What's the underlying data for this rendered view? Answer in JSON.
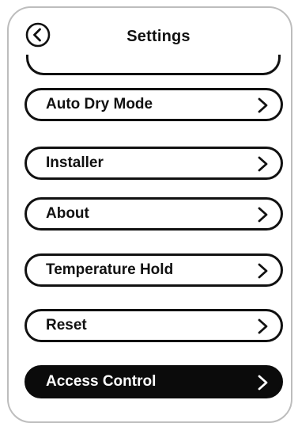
{
  "header": {
    "title": "Settings",
    "back_icon": "chevron-left-circle-icon"
  },
  "menu": {
    "items": [
      {
        "label": "Auto Dry Mode",
        "icon": "chevron-right-icon"
      },
      {
        "label": "Installer",
        "icon": "chevron-right-icon"
      },
      {
        "label": "About",
        "icon": "chevron-right-icon"
      },
      {
        "label": "Temperature Hold",
        "icon": "chevron-right-icon"
      },
      {
        "label": "Reset",
        "icon": "chevron-right-icon"
      },
      {
        "label": "Access Control",
        "icon": "chevron-right-icon",
        "selected": true
      }
    ]
  },
  "colors": {
    "foreground": "#111111",
    "selected_background": "#0b0b0b",
    "selected_text": "#ffffff",
    "bezel": "#bdbdbd"
  }
}
